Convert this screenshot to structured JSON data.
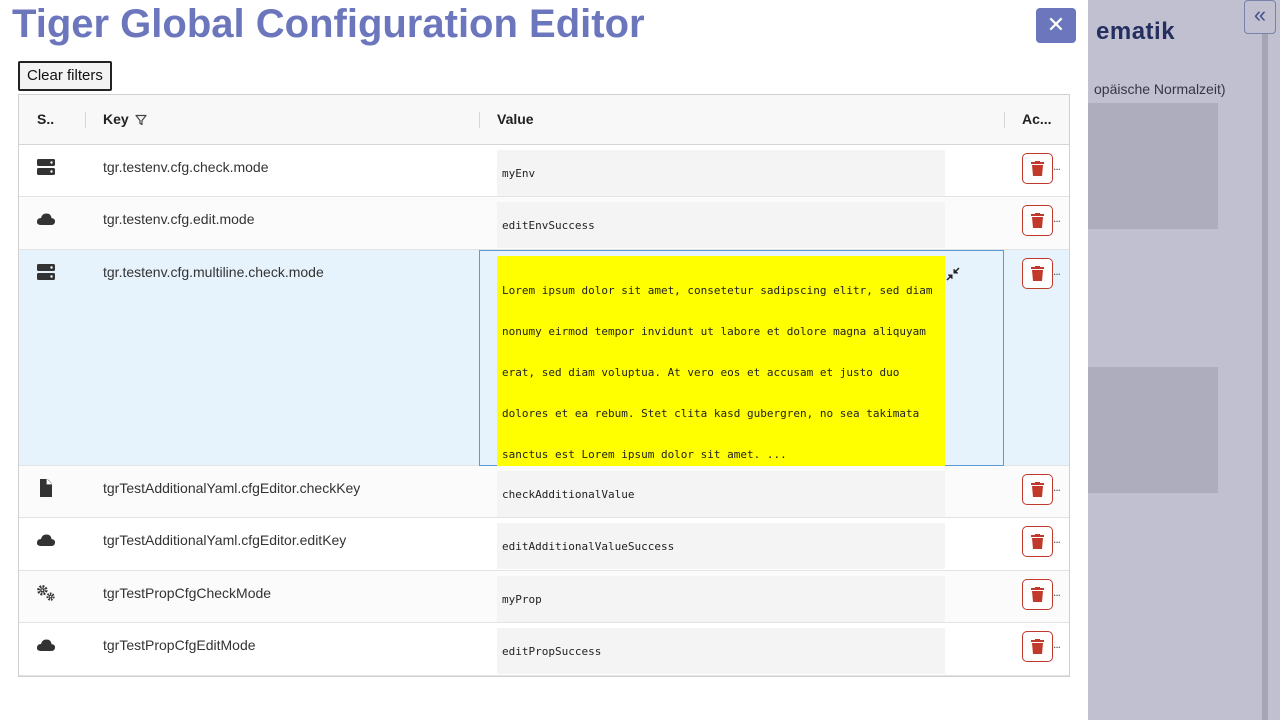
{
  "colors": {
    "accent": "#6b76bd",
    "delete": "#c0392b",
    "highlight": "#ffff00",
    "selected_row": "#e6f2fc"
  },
  "background_app": {
    "brand": "ematik",
    "timezone_text": "opäische Normalzeit)",
    "collapse_glyph": "«"
  },
  "editor": {
    "title": "Tiger Global Configuration Editor",
    "close_glyph": "✕",
    "clear_filters_label": "Clear filters",
    "columns": {
      "source": "S..",
      "key": "Key",
      "value": "Value",
      "actions": "Ac..."
    },
    "more_glyph": "...",
    "rows": [
      {
        "source_icon": "server-icon",
        "key": "tgr.testenv.cfg.check.mode",
        "value": "myEnv"
      },
      {
        "source_icon": "cloud-icon",
        "key": "tgr.testenv.cfg.edit.mode",
        "value": "editEnvSuccess"
      },
      {
        "source_icon": "server-icon",
        "key": "tgr.testenv.cfg.multiline.check.mode",
        "value": "Lorem ipsum dolor sit amet, consetetur sadipscing elitr, sed diam\nnonumy eirmod tempor invidunt ut labore et dolore magna aliquyam\nerat, sed diam voluptua. At vero eos et accusam et justo duo\ndolores et ea rebum. Stet clita kasd gubergren, no sea takimata\nsanctus est Lorem ipsum dolor sit amet. ..."
      },
      {
        "source_icon": "file-icon",
        "key": "tgrTestAdditionalYaml.cfgEditor.checkKey",
        "value": "checkAdditionalValue"
      },
      {
        "source_icon": "cloud-icon",
        "key": "tgrTestAdditionalYaml.cfgEditor.editKey",
        "value": "editAdditionalValueSuccess"
      },
      {
        "source_icon": "gears-icon",
        "key": "tgrTestPropCfgCheckMode",
        "value": "myProp"
      },
      {
        "source_icon": "cloud-icon",
        "key": "tgrTestPropCfgEditMode",
        "value": "editPropSuccess"
      }
    ]
  }
}
